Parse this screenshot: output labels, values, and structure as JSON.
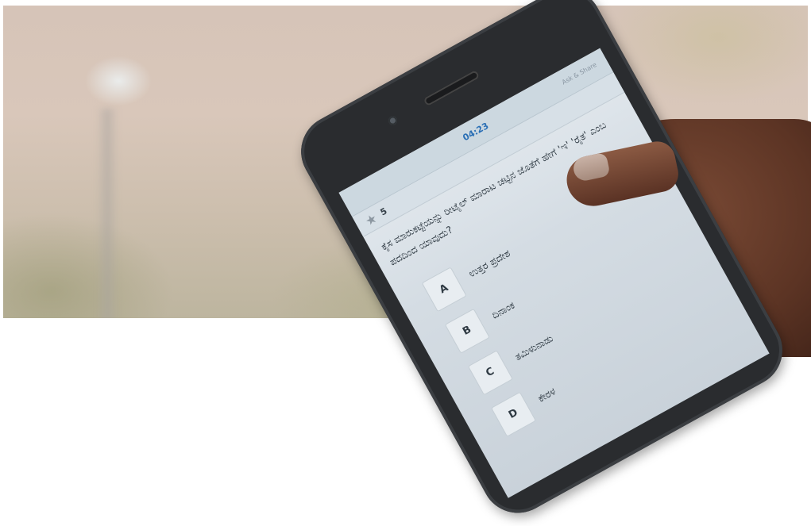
{
  "screen": {
    "header": {
      "timer": "04:23",
      "link": "Ask & Share"
    },
    "score_bar": {
      "icon": "star-icon",
      "score": "5"
    },
    "question": "ಕೈಸ ಮಾರುಕಟ್ಟೆಯನ್ನು ರೀಟೈಲ್ ಮಾರಾಟ ಚಟ್ಟಿನ ಜೊತೆಗೆ ಹೇಗೆ 'ಇ' 'ರೈತ' ಎಂಬ ಪದದಿಂದ ಯಾವುದು?",
    "options": [
      {
        "letter": "A",
        "text": "ಉತ್ತರ ಪ್ರದೇಶ"
      },
      {
        "letter": "B",
        "text": "ದಿನಾಂಕ"
      },
      {
        "letter": "C",
        "text": "ತಮಿಳುನಾಡು"
      },
      {
        "letter": "D",
        "text": "ಕೇರಳ"
      }
    ]
  }
}
